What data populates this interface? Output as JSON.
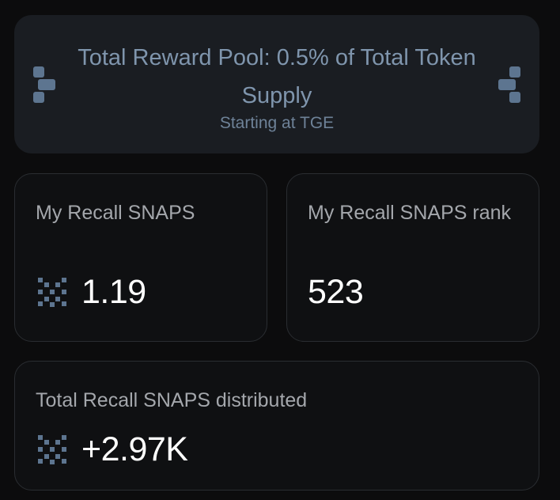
{
  "banner": {
    "title": "Total Reward Pool: 0.5% of Total Token Supply",
    "subtitle": "Starting at TGE",
    "left_icon": "puzzle-piece-icon",
    "right_icon": "puzzle-piece-icon"
  },
  "cards": {
    "my_snaps": {
      "label": "My Recall SNAPS",
      "value": "1.19",
      "icon": "snaps-token-icon"
    },
    "my_rank": {
      "label": "My Recall SNAPS rank",
      "value": "523"
    },
    "total_distributed": {
      "label": "Total Recall SNAPS distributed",
      "value": "+2.97K",
      "icon": "snaps-token-icon"
    }
  },
  "colors": {
    "background": "#0c0c0d",
    "banner_bg": "#1a1d22",
    "banner_text": "#7f95ad",
    "icon_color": "#5d7590",
    "card_border": "#2a2d31",
    "label_text": "#a4a7ac",
    "value_text": "#ffffff"
  }
}
